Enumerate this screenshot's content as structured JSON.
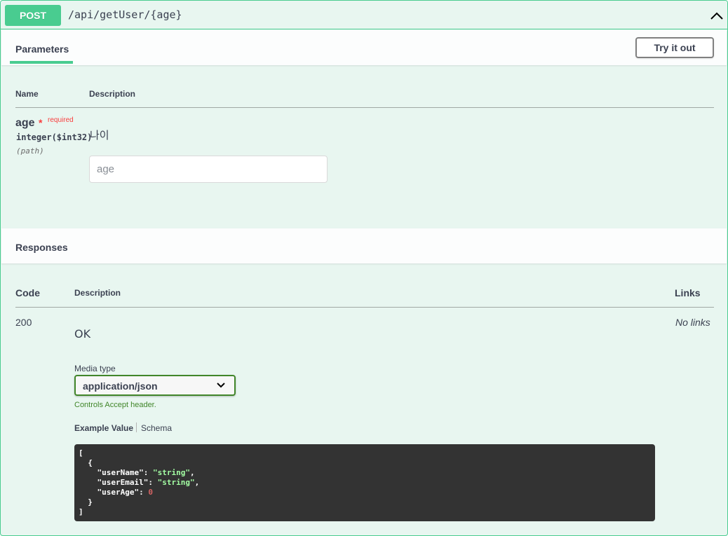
{
  "operation": {
    "method": "POST",
    "path": "/api/getUser/{age}",
    "method_color": "#49cc90"
  },
  "parameters": {
    "tab_label": "Parameters",
    "try_button": "Try it out",
    "headers": {
      "name": "Name",
      "description": "Description"
    },
    "items": [
      {
        "name": "age",
        "required_mark": "*",
        "required_label": "required",
        "type": "integer($int32)",
        "location": "(path)",
        "description": "나이",
        "input_placeholder": "age"
      }
    ]
  },
  "responses": {
    "title": "Responses",
    "headers": {
      "code": "Code",
      "description": "Description",
      "links": "Links"
    },
    "items": [
      {
        "code": "200",
        "description": "OK",
        "links": "No links",
        "media_type_label": "Media type",
        "media_type_value": "application/json",
        "controls_note": "Controls Accept header.",
        "example_tab": "Example Value",
        "schema_tab": "Schema",
        "example": {
          "open_bracket": "[",
          "open_brace": "{",
          "fields": [
            {
              "key": "\"userName\"",
              "value": "\"string\"",
              "kind": "string",
              "comma": ","
            },
            {
              "key": "\"userEmail\"",
              "value": "\"string\"",
              "kind": "string",
              "comma": ","
            },
            {
              "key": "\"userAge\"",
              "value": "0",
              "kind": "number",
              "comma": ""
            }
          ],
          "close_brace": "}",
          "close_bracket": "]"
        }
      }
    ]
  },
  "icons": {
    "collapse": "chevron-up-icon",
    "select": "chevron-down-icon"
  },
  "colors": {
    "accent": "#49cc90",
    "required": "#f93e3e",
    "media_border": "#41862a",
    "code_bg": "#333333",
    "string": "#a2fca2",
    "number": "#d36363"
  }
}
